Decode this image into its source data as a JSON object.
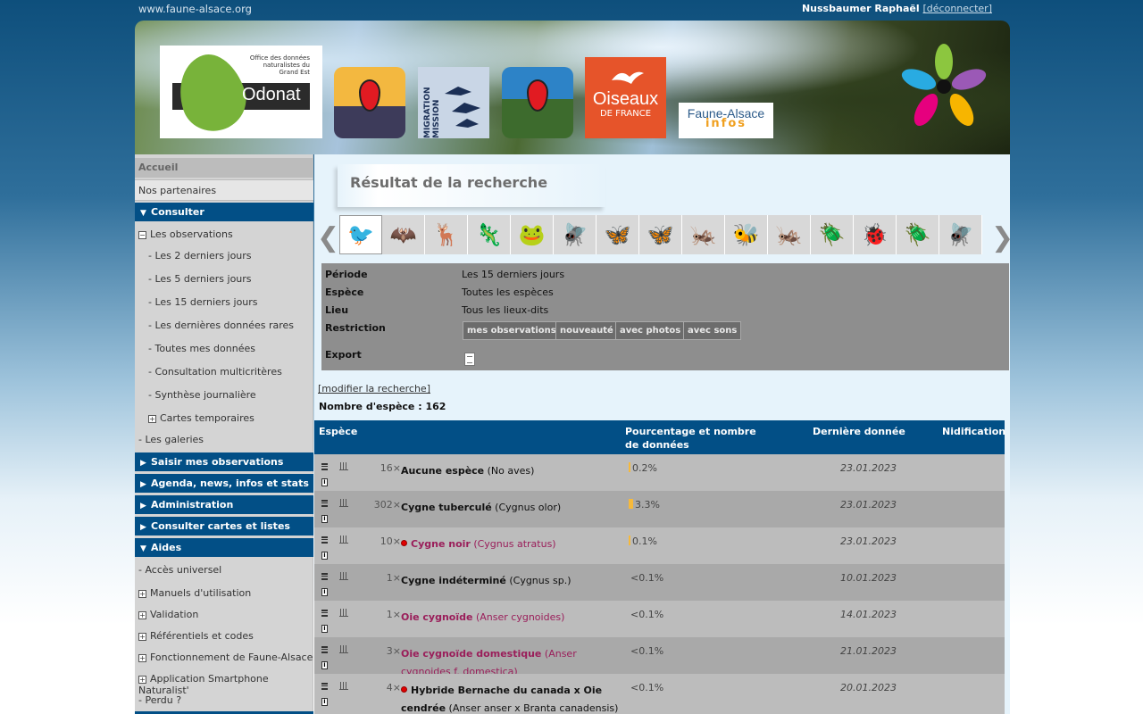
{
  "top": {
    "site_url": "www.faune-alsace.org",
    "user": "Nussbaumer Raphaël",
    "logout": "[déconnecter]"
  },
  "banner": {
    "odonat_name": "Odonat",
    "odonat_small": "Office des données naturalistes du Grand Est",
    "migration_text": "MIGRATION MISSION",
    "oiseaux_big": "Oiseaux",
    "oiseaux_mid": "DE FRANCE",
    "infos_line1": "Faune-Alsace",
    "infos_line2": "infos"
  },
  "sidebar": {
    "accueil": "Accueil",
    "partenaires": "Nos partenaires",
    "consulter": "Consulter",
    "observations": "Les observations",
    "obs_items": [
      "- Les 2 derniers jours",
      "- Les 5 derniers jours",
      "- Les 15 derniers jours",
      "- Les dernières données rares",
      "- Toutes mes données",
      "- Consultation multicritères",
      "- Synthèse journalière"
    ],
    "cartes": "Cartes temporaires",
    "galeries": "- Les galeries",
    "saisir": "Saisir mes observations",
    "agenda": "Agenda, news, infos et stats",
    "admin": "Administration",
    "cartes_listes": "Consulter cartes et listes",
    "aides": "Aides",
    "acces": "- Accès universel",
    "aide_items": [
      "Manuels d'utilisation",
      "Validation",
      "Référentiels et codes",
      "Fonctionnement de Faune-Alsace",
      "Application Smartphone Naturalist'"
    ],
    "perdu": "- Perdu ?"
  },
  "content": {
    "title": "Résultat de la recherche",
    "taxa_icons": [
      "bird-icon",
      "bat-icon",
      "deer-icon",
      "lizard-icon",
      "frog-icon",
      "dragonfly-icon",
      "butterfly-icon",
      "moth-icon",
      "grasshopper-icon",
      "bee-icon",
      "mantis-icon",
      "cicada-icon",
      "ladybird-icon",
      "beetle-icon",
      "fly-icon"
    ],
    "taxa_glyphs": [
      "🐦",
      "🦇",
      "🦌",
      "🦎",
      "🐸",
      "🪰",
      "🦋",
      "🦋",
      "🦗",
      "🐝",
      "🦗",
      "🪲",
      "🐞",
      "🪲",
      "🪰"
    ],
    "criteria": {
      "periode_lbl": "Période",
      "periode_val": "Les 15 derniers jours",
      "espece_lbl": "Espèce",
      "espece_val": "Toutes les espèces",
      "lieu_lbl": "Lieu",
      "lieu_val": "Tous les lieux-dits",
      "restriction_lbl": "Restriction",
      "restriction_btns": [
        "mes observations",
        "nouveauté",
        "avec photos",
        "avec sons"
      ],
      "export_lbl": "Export"
    },
    "modify": "[modifier la recherche]",
    "count_label": "Nombre d'espèce : ",
    "count_value": "162",
    "table_headers": {
      "espece": "Espèce",
      "pct": "Pourcentage et nombre de données",
      "last": "Dernière donnée",
      "nid": "Nidification"
    },
    "rows": [
      {
        "count": "16×",
        "name": "Aucune espèce",
        "latin": "(No aves)",
        "rare": false,
        "dot": false,
        "pct": "0.2%",
        "bar": 0.2,
        "date": "23.01.2023"
      },
      {
        "count": "302×",
        "name": "Cygne tuberculé",
        "latin": "(Cygnus olor)",
        "rare": false,
        "dot": false,
        "pct": "3.3%",
        "bar": 3.3,
        "date": "23.01.2023"
      },
      {
        "count": "10×",
        "name": "Cygne noir",
        "latin": "(Cygnus atratus)",
        "rare": true,
        "dot": true,
        "pct": "0.1%",
        "bar": 0.1,
        "date": "23.01.2023"
      },
      {
        "count": "1×",
        "name": "Cygne indéterminé",
        "latin": "(Cygnus sp.)",
        "rare": false,
        "dot": false,
        "pct": "<0.1%",
        "bar": 0,
        "date": "10.01.2023"
      },
      {
        "count": "1×",
        "name": "Oie cygnoïde",
        "latin": "(Anser cygnoides)",
        "rare": true,
        "dot": false,
        "pct": "<0.1%",
        "bar": 0,
        "date": "14.01.2023"
      },
      {
        "count": "3×",
        "name": "Oie cygnoïde domestique",
        "latin": "(Anser cygnoides f. domestica)",
        "rare": true,
        "dot": false,
        "pct": "<0.1%",
        "bar": 0,
        "date": "21.01.2023"
      },
      {
        "count": "4×",
        "name": "Hybride Bernache du canada x Oie cendrée",
        "latin": "(Anser anser x Branta canadensis)",
        "rare": false,
        "dot": true,
        "pct": "<0.1%",
        "bar": 0,
        "date": "20.01.2023"
      }
    ]
  },
  "colors": {
    "nav_blue": "#024f86",
    "rare_text": "#9a1e5a",
    "bar": "#f6b93b"
  }
}
